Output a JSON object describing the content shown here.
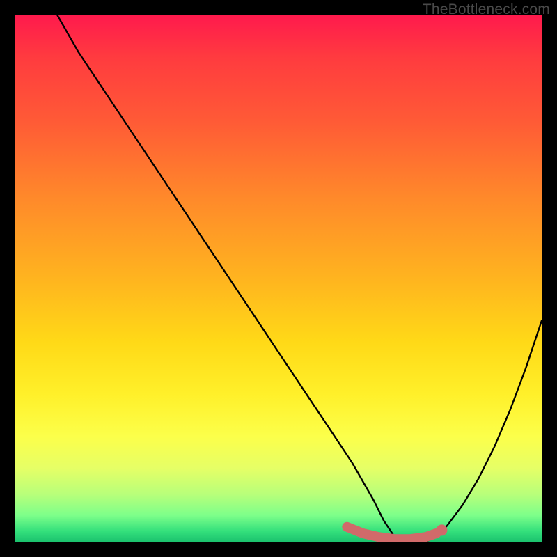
{
  "watermark": "TheBottleneck.com",
  "chart_data": {
    "type": "line",
    "title": "",
    "xlabel": "",
    "ylabel": "",
    "xlim": [
      0,
      100
    ],
    "ylim": [
      0,
      100
    ],
    "grid": false,
    "background_gradient": {
      "top": "#ff1a4d",
      "mid": "#fff02a",
      "bottom": "#1bc26e"
    },
    "series": [
      {
        "name": "bottleneck-curve",
        "color": "#000000",
        "x": [
          8,
          12,
          18,
          24,
          30,
          36,
          42,
          48,
          54,
          60,
          64,
          68,
          70,
          72,
          74,
          76,
          78,
          80,
          82,
          85,
          88,
          91,
          94,
          97,
          100
        ],
        "values": [
          100,
          93,
          84,
          75,
          66,
          57,
          48,
          39,
          30,
          21,
          15,
          8,
          4,
          1,
          0,
          0,
          0,
          1,
          3,
          7,
          12,
          18,
          25,
          33,
          42
        ]
      }
    ],
    "marker_segment": {
      "name": "optimal-range",
      "color": "#d16a6a",
      "x": [
        63,
        66,
        69,
        72,
        75,
        78,
        80
      ],
      "values": [
        2.8,
        1.6,
        0.9,
        0.5,
        0.5,
        0.9,
        1.6
      ],
      "end_point": {
        "x": 81,
        "y": 2.2
      }
    }
  }
}
